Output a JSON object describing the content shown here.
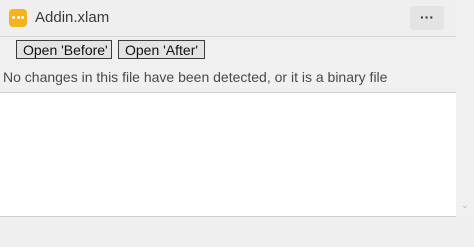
{
  "header": {
    "file_name": "Addin.xlam",
    "more_label": "···",
    "icon_color": "#f4b41a",
    "file_icon": "file-dots-icon"
  },
  "toolbar": {
    "open_before_label": "Open 'Before'",
    "open_after_label": "Open 'After'"
  },
  "main": {
    "message": "No changes in this file have been detected, or it is a binary file"
  },
  "scrollbar": {
    "down_arrow_icon": "chevron-down-icon",
    "arrow_glyph": "⌄"
  }
}
